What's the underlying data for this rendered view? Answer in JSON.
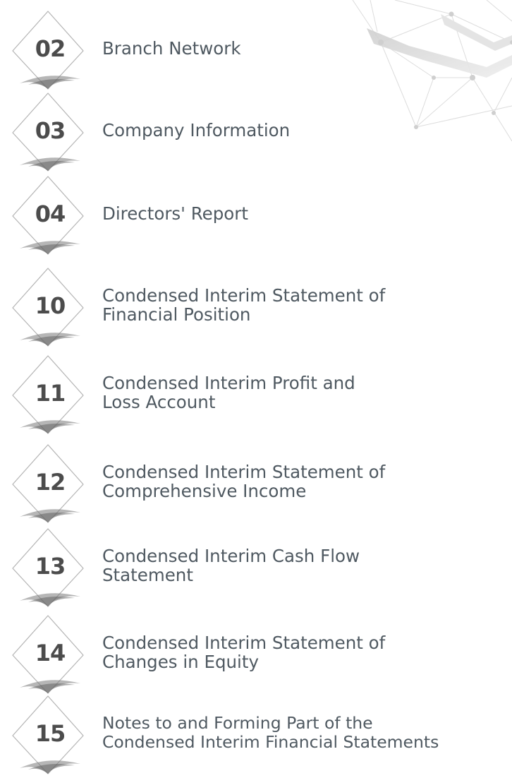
{
  "contents": {
    "entries": [
      {
        "page": "02",
        "title": "Branch Network"
      },
      {
        "page": "03",
        "title": "Company Information"
      },
      {
        "page": "04",
        "title": "Directors' Report"
      },
      {
        "page": "10",
        "title": "Condensed Interim Statement of\nFinancial Position"
      },
      {
        "page": "11",
        "title": "Condensed Interim Profit and\nLoss Account"
      },
      {
        "page": "12",
        "title": "Condensed Interim Statement of\nComprehensive Income"
      },
      {
        "page": "13",
        "title": "Condensed Interim Cash Flow\nStatement"
      },
      {
        "page": "14",
        "title": "Condensed Interim Statement of\nChanges in Equity"
      },
      {
        "page": "15",
        "title": "Notes to and Forming Part of the\nCondensed Interim Financial Statements"
      }
    ]
  },
  "colors": {
    "number_text": "#4c4c4c",
    "title_text": "#4f5961",
    "badge_outline": "#b4b4b4",
    "badge_shadow": "#6e6e6e",
    "network_lines": "#d9d9d9"
  }
}
